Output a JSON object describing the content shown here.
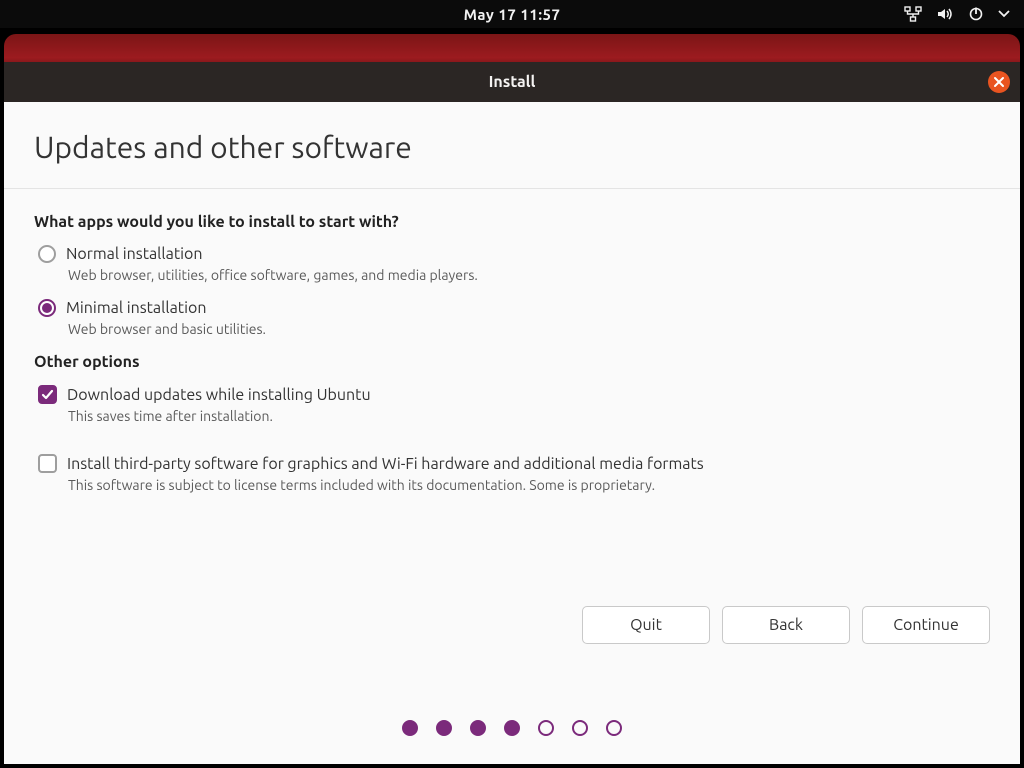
{
  "top_panel": {
    "clock": "May 17  11:57"
  },
  "window": {
    "title": "Install",
    "page_title": "Updates and other software",
    "close_label": "Close"
  },
  "install_type": {
    "question": "What apps would you like to install to start with?",
    "selected": "minimal",
    "options": {
      "normal": {
        "label": "Normal installation",
        "desc": "Web browser, utilities, office software, games, and media players."
      },
      "minimal": {
        "label": "Minimal installation",
        "desc": "Web browser and basic utilities."
      }
    }
  },
  "other_options": {
    "heading": "Other options",
    "download_updates": {
      "label": "Download updates while installing Ubuntu",
      "desc": "This saves time after installation.",
      "checked": true
    },
    "third_party": {
      "label": "Install third-party software for graphics and Wi-Fi hardware and additional media formats",
      "desc": "This software is subject to license terms included with its documentation. Some is proprietary.",
      "checked": false
    }
  },
  "footer": {
    "quit": "Quit",
    "back": "Back",
    "continue": "Continue"
  },
  "stepper": {
    "total": 7,
    "current": 4
  },
  "colors": {
    "accent": "#7b2a7b",
    "close": "#e95420",
    "backdrop": "#9c1b1f"
  }
}
